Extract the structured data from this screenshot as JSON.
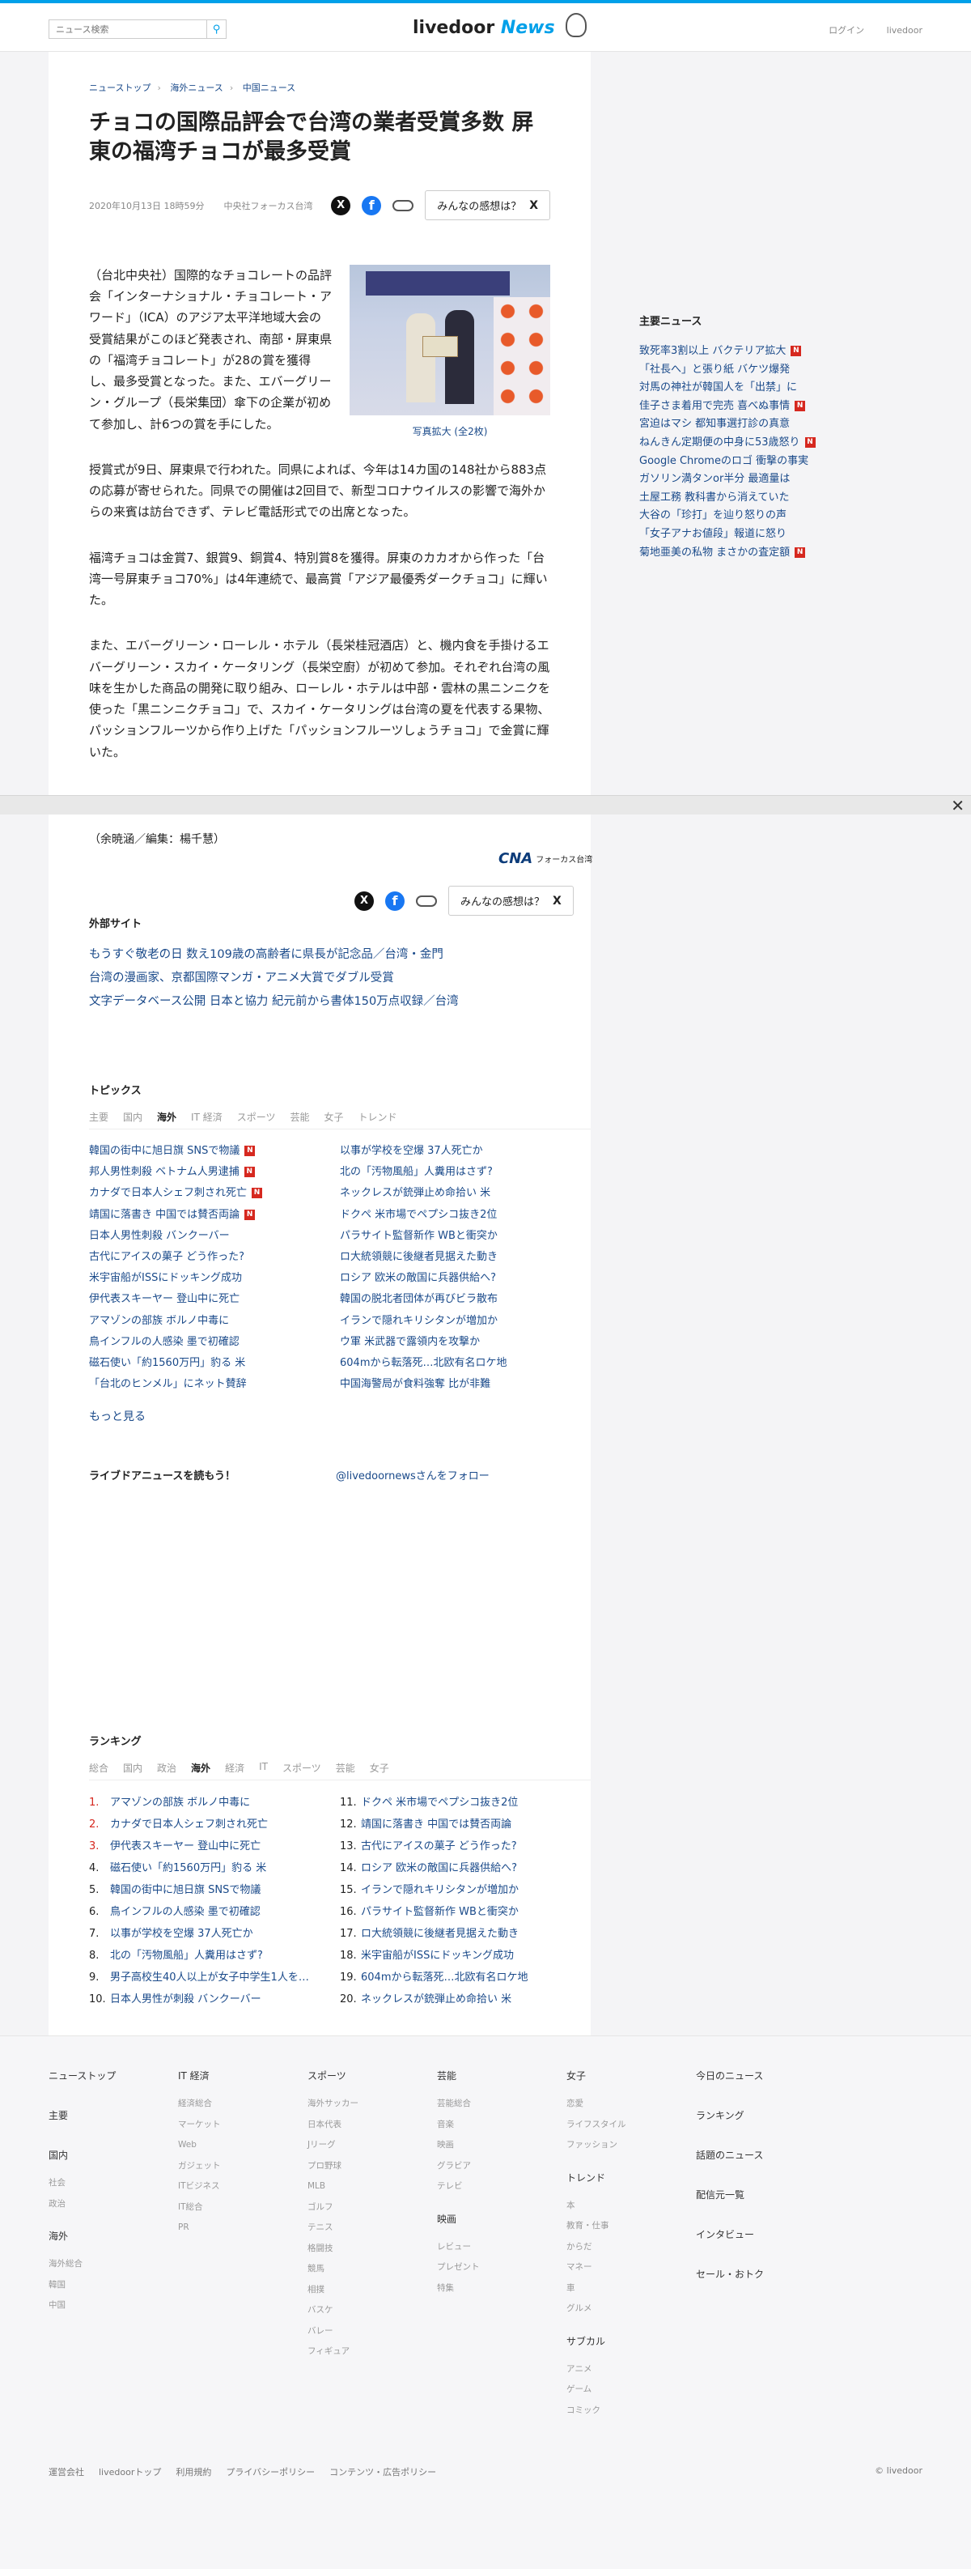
{
  "header": {
    "search_placeholder": "ニュース検索",
    "logo_main": "livedoor",
    "logo_news": "News",
    "login": "ログイン",
    "livedoor": "livedoor"
  },
  "breadcrumb": [
    "ニューストップ",
    "海外ニュース",
    "中国ニュース"
  ],
  "article": {
    "title": "チョコの国際品評会で台湾の業者受賞多数 屏東の福湾チョコが最多受賞",
    "date": "2020年10月13日 18時59分",
    "source": "中央社フォーカス台湾",
    "kansou_label": "みんなの感想は？",
    "photo_caption": "写真拡大 (全2枚)",
    "paragraphs": [
      "（台北中央社）国際的なチョコレートの品評会「インターナショナル・チョコレート・アワード」（ICA）のアジア太平洋地域大会の受賞結果がこのほど発表され、南部・屏東県の「福湾チョコレート」が28の賞を獲得し、最多受賞となった。また、エバーグリーン・グループ（長栄集団）傘下の企業が初めて参加し、計6つの賞を手にした。",
      "授賞式が9日、屏東県で行われた。同県によれば、今年は14カ国の148社から883点の応募が寄せられた。同県での開催は2回目で、新型コロナウイルスの影響で海外からの来賓は訪台できず、テレビ電話形式での出席となった。",
      "福湾チョコは金賞7、銀賞9、銅賞4、特別賞8を獲得。屏東のカカオから作った「台湾一号屏東チョコ70%」は4年連続で、最高賞「アジア最優秀ダークチョコ」に輝いた。",
      "また、エバーグリーン・ローレル・ホテル（長栄桂冠酒店）と、機内食を手掛けるエバーグリーン・スカイ・ケータリング（長栄空廚）が初めて参加。それぞれ台湾の風味を生かした商品の開発に取り組み、ローレル・ホテルは中部・雲林の黒ニンニクを使った「黒ニンニクチョコ」で、スカイ・ケータリングは台湾の夏を代表する果物、パッションフルーツから作り上げた「パッションフルーツしょうチョコ」で金賞に輝いた。"
    ],
    "credit": "（余暁涵／編集：楊千慧）",
    "cna_mark": "CNA",
    "cna_text": "フォーカス台湾"
  },
  "external": {
    "title": "外部サイト",
    "links": [
      "もうすぐ敬老の日 数え109歳の高齢者に県長が記念品／台湾・金門",
      "台湾の漫画家、京都国際マンガ・アニメ大賞でダブル受賞",
      "文字データベース公開 日本と協力 紀元前から書体150万点収録／台湾"
    ]
  },
  "topics": {
    "title": "トピックス",
    "tabs": [
      "主要",
      "国内",
      "海外",
      "IT 経済",
      "スポーツ",
      "芸能",
      "女子",
      "トレンド"
    ],
    "active_tab": 2,
    "left": [
      {
        "text": "韓国の街中に旭日旗 SNSで物議",
        "badge": "N"
      },
      {
        "text": "邦人男性刺殺 ベトナム人男逮捕",
        "badge": "N"
      },
      {
        "text": "カナダで日本人シェフ刺され死亡",
        "badge": "N"
      },
      {
        "text": "靖国に落書き 中国では賛否両論",
        "badge": "N"
      },
      {
        "text": "日本人男性刺殺 バンクーバー",
        "badge": ""
      },
      {
        "text": "古代にアイスの菓子 どう作った?",
        "badge": ""
      },
      {
        "text": "米宇宙船がISSにドッキング成功",
        "badge": ""
      },
      {
        "text": "伊代表スキーヤー 登山中に死亡",
        "badge": ""
      },
      {
        "text": "アマゾンの部族 ボルノ中毒に",
        "badge": ""
      },
      {
        "text": "鳥インフルの人感染 墨で初確認",
        "badge": ""
      },
      {
        "text": "磁石使い「約1560万円」豹る 米",
        "badge": ""
      },
      {
        "text": "「台北のヒンメル」にネット賛辞",
        "badge": ""
      }
    ],
    "right": [
      {
        "text": "以事が学校を空爆 37人死亡か",
        "badge": ""
      },
      {
        "text": "北の「汚物風船」人糞用はさず?",
        "badge": ""
      },
      {
        "text": "ネックレスが銃弾止め命拾い 米",
        "badge": ""
      },
      {
        "text": "ドクペ 米市場でペプシコ抜き2位",
        "badge": ""
      },
      {
        "text": "パラサイト監督新作 WBと衝突か",
        "badge": ""
      },
      {
        "text": "ロ大統領競に後継者見据えた動き",
        "badge": ""
      },
      {
        "text": "ロシア 欧米の敵国に兵器供給へ?",
        "badge": ""
      },
      {
        "text": "韓国の脱北者団体が再びビラ散布",
        "badge": ""
      },
      {
        "text": "イランで隠れキリシタンが増加か",
        "badge": ""
      },
      {
        "text": "ウ軍 米武器で露領内を攻撃か",
        "badge": ""
      },
      {
        "text": "604mから転落死…北欧有名ロケ地",
        "badge": ""
      },
      {
        "text": "中国海警局が食料強奪 比が非難",
        "badge": ""
      }
    ],
    "more": "もっと見る"
  },
  "manga": {
    "title": "ライブドアニュースを読もう！",
    "follow": "@livedoornewsさんをフォロー"
  },
  "ranking": {
    "title": "ランキング",
    "tabs": [
      "総合",
      "国内",
      "政治",
      "海外",
      "経済",
      "IT",
      "スポーツ",
      "芸能",
      "女子"
    ],
    "active_tab": 3,
    "left": [
      {
        "n": "1.",
        "text": "アマゾンの部族 ボルノ中毒に"
      },
      {
        "n": "2.",
        "text": "カナダで日本人シェフ刺され死亡"
      },
      {
        "n": "3.",
        "text": "伊代表スキーヤー 登山中に死亡"
      },
      {
        "n": "4.",
        "text": "磁石使い「約1560万円」豹る 米"
      },
      {
        "n": "5.",
        "text": "韓国の街中に旭日旗 SNSで物議"
      },
      {
        "n": "6.",
        "text": "鳥インフルの人感染 墨で初確認"
      },
      {
        "n": "7.",
        "text": "以事が学校を空爆 37人死亡か"
      },
      {
        "n": "8.",
        "text": "北の「汚物風船」人糞用はさず?"
      },
      {
        "n": "9.",
        "text": "男子高校生40人以上が女子中学生1人を…"
      },
      {
        "n": "10.",
        "text": "日本人男性が刺殺 バンクーバー"
      }
    ],
    "right": [
      {
        "n": "11.",
        "text": "ドクペ 米市場でペプシコ抜き2位"
      },
      {
        "n": "12.",
        "text": "靖国に落書き 中国では賛否両論"
      },
      {
        "n": "13.",
        "text": "古代にアイスの菓子 どう作った?"
      },
      {
        "n": "14.",
        "text": "ロシア 欧米の敵国に兵器供給へ?"
      },
      {
        "n": "15.",
        "text": "イランで隠れキリシタンが増加か"
      },
      {
        "n": "16.",
        "text": "パラサイト監督新作 WBと衝突か"
      },
      {
        "n": "17.",
        "text": "ロ大統領競に後継者見据えた動き"
      },
      {
        "n": "18.",
        "text": "米宇宙船がISSにドッキング成功"
      },
      {
        "n": "19.",
        "text": "604mから転落死…北欧有名ロケ地"
      },
      {
        "n": "20.",
        "text": "ネックレスが銃弾止め命拾い 米"
      }
    ]
  },
  "sidebar": {
    "title": "主要ニュース",
    "items": [
      {
        "text": "致死率3割以上 バクテリア拡大",
        "badge": "N"
      },
      {
        "text": "「社長へ」と張り紙 バケツ爆発",
        "badge": ""
      },
      {
        "text": "対馬の神社が韓国人を「出禁」に",
        "badge": ""
      },
      {
        "text": "佳子さま着用で完売 喜べぬ事情",
        "badge": "N"
      },
      {
        "text": "宮迫はマシ 都知事選打診の真意",
        "badge": ""
      },
      {
        "text": "ねんきん定期便の中身に53歳怒り",
        "badge": "N"
      },
      {
        "text": "Google Chromeのロゴ 衝撃の事実",
        "badge": ""
      },
      {
        "text": "ガソリン満タンor半分 最適量は",
        "badge": ""
      },
      {
        "text": "土屋工務 教科書から消えていた",
        "badge": ""
      },
      {
        "text": "大谷の「珍打」を辿り怒りの声",
        "badge": ""
      },
      {
        "text": "「女子アナお値段」報道に怒り",
        "badge": ""
      },
      {
        "text": "菊地亜美の私物 まさかの査定額",
        "badge": "N"
      }
    ]
  },
  "footer": {
    "cols": [
      {
        "groups": [
          {
            "head": "ニューストップ",
            "subs": []
          },
          {
            "head": "主要",
            "subs": []
          },
          {
            "head": "国内",
            "subs": [
              "社会",
              "政治"
            ]
          },
          {
            "head": "海外",
            "subs": [
              "海外総合",
              "韓国",
              "中国"
            ]
          }
        ]
      },
      {
        "groups": [
          {
            "head": "IT 経済",
            "subs": [
              "経済総合",
              "マーケット",
              "Web",
              "ガジェット",
              "ITビジネス",
              "IT総合",
              "PR"
            ]
          }
        ]
      },
      {
        "groups": [
          {
            "head": "スポーツ",
            "subs": [
              "海外サッカー",
              "日本代表",
              "Jリーグ",
              "プロ野球",
              "MLB",
              "ゴルフ",
              "テニス",
              "格闘技",
              "競馬",
              "相撲",
              "バスケ",
              "バレー",
              "フィギュア"
            ]
          }
        ]
      },
      {
        "groups": [
          {
            "head": "芸能",
            "subs": [
              "芸能総合",
              "音楽",
              "映画",
              "グラビア",
              "テレビ"
            ]
          },
          {
            "head": "映画",
            "subs": [
              "レビュー",
              "プレゼント",
              "特集"
            ]
          }
        ]
      },
      {
        "groups": [
          {
            "head": "女子",
            "subs": [
              "恋愛",
              "ライフスタイル",
              "ファッション"
            ]
          },
          {
            "head": "トレンド",
            "subs": [
              "本",
              "教育・仕事",
              "からだ",
              "マネー",
              "車",
              "グルメ"
            ]
          },
          {
            "head": "サブカル",
            "subs": [
              "アニメ",
              "ゲーム",
              "コミック"
            ]
          }
        ]
      },
      {
        "groups": [
          {
            "head": "今日のニュース",
            "subs": []
          },
          {
            "head": "ランキング",
            "subs": []
          },
          {
            "head": "話題のニュース",
            "subs": []
          },
          {
            "head": "配信元一覧",
            "subs": []
          },
          {
            "head": "インタビュー",
            "subs": []
          },
          {
            "head": "セール・おトク",
            "subs": []
          }
        ]
      }
    ],
    "bottom_links": [
      "運営会社",
      "livedoorトップ",
      "利用規約",
      "プライバシーポリシー",
      "コンテンツ・広告ポリシー"
    ],
    "copyright": "© livedoor"
  }
}
